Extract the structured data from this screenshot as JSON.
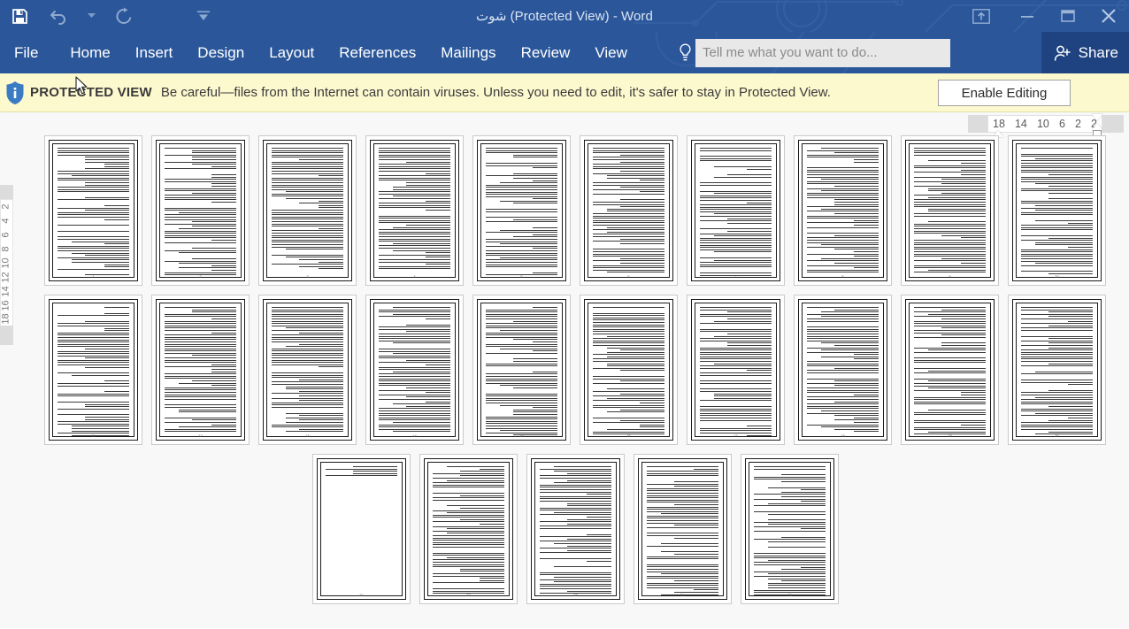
{
  "window": {
    "title": "شوت (Protected View) - Word",
    "titlebar_color": "#2b579a",
    "controls": [
      {
        "name": "ribbon-display-options",
        "label": "Ribbon Display Options"
      },
      {
        "name": "minimize",
        "label": "Minimize"
      },
      {
        "name": "restore",
        "label": "Restore Down"
      },
      {
        "name": "close",
        "label": "Close"
      }
    ]
  },
  "quick_access": [
    {
      "icon": "save-icon",
      "label": "Save"
    },
    {
      "icon": "undo-icon",
      "label": "Undo"
    },
    {
      "icon": "undo-dropdown-icon",
      "label": "Undo options"
    },
    {
      "icon": "redo-icon",
      "label": "Repeat"
    },
    {
      "icon": "customize-qat-icon",
      "label": "Customize Quick Access Toolbar"
    }
  ],
  "ribbon": {
    "tabs": [
      {
        "label": "File"
      },
      {
        "label": "Home"
      },
      {
        "label": "Insert"
      },
      {
        "label": "Design"
      },
      {
        "label": "Layout"
      },
      {
        "label": "References"
      },
      {
        "label": "Mailings"
      },
      {
        "label": "Review"
      },
      {
        "label": "View"
      }
    ],
    "tellme": {
      "placeholder": "Tell me what you want to do...",
      "value": "",
      "icon": "lightbulb-icon"
    },
    "share": {
      "label": "Share",
      "icon": "share-person-icon"
    }
  },
  "protected_view": {
    "icon": "info-shield-icon",
    "label": "PROTECTED VIEW",
    "message": "Be careful—files from the Internet can contain viruses. Unless you need to edit, it's safer to stay in Protected View.",
    "enable_button": "Enable Editing",
    "background_color": "#fdf9cf"
  },
  "ruler": {
    "horizontal_ticks": [
      "18",
      "14",
      "10",
      "6",
      "2",
      "2"
    ],
    "vertical_ticks": [
      "2",
      "4",
      "6",
      "8",
      "10",
      "12",
      "14",
      "16",
      "18"
    ]
  },
  "document": {
    "zoom_layout": "multiple-pages",
    "rows": [
      {
        "page_count": 10
      },
      {
        "page_count": 10
      },
      {
        "page_count": 5
      }
    ],
    "total_pages": 25,
    "page_numbers": [
      "1",
      "2",
      "3",
      "4",
      "5",
      "6",
      "7",
      "8",
      "9",
      "10",
      "11",
      "12",
      "13",
      "14",
      "15",
      "16",
      "17",
      "18",
      "19",
      "20",
      "21",
      "22",
      "23",
      "24",
      "25"
    ]
  }
}
